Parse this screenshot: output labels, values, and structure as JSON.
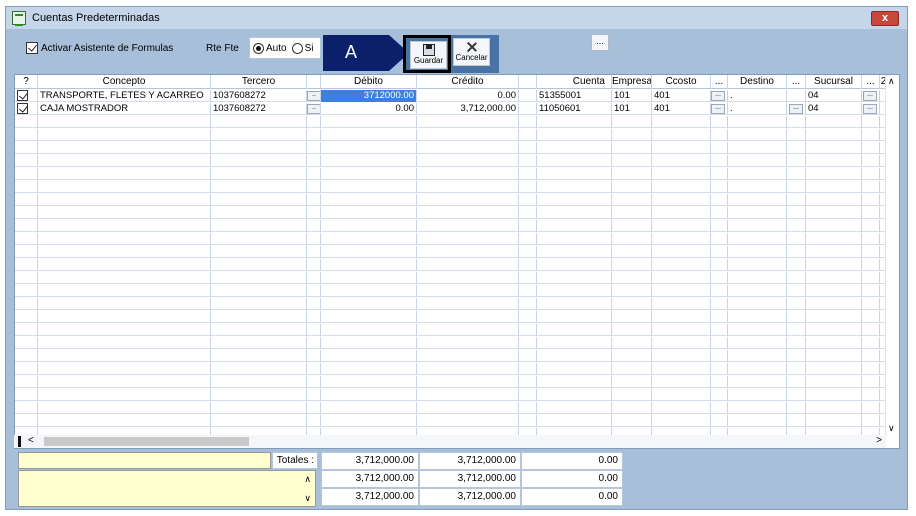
{
  "window": {
    "title": "Cuentas Predeterminadas",
    "close_label": "x"
  },
  "toolbar": {
    "asistente_label": "Activar Asistente de Formulas",
    "asistente_checked": true,
    "rte_label": "Rte Fte",
    "radio_auto_label": "Auto",
    "radio_si_label": "Si",
    "radio_selected": "Auto",
    "marker_label": "A",
    "guardar_label": "Guardar",
    "cancelar_label": "Cancelar",
    "extra_label": "..."
  },
  "grid": {
    "columns": [
      "?",
      "Concepto",
      "Tercero",
      "",
      "Débito",
      "Crédito",
      "",
      "Cuenta",
      "Empresa",
      "Ccosto",
      "...",
      "Destino",
      "...",
      "Sucursal",
      "...",
      "2"
    ],
    "rows": [
      {
        "checked": true,
        "concepto": "TRANSPORTE, FLETES Y ACARREO",
        "tercero": "1037608272",
        "debito": "3712000.00",
        "credito": "0.00",
        "cuenta": "51355001",
        "empresa": "101",
        "ccosto": "401",
        "destino": ".",
        "sucursal": "04"
      },
      {
        "checked": true,
        "concepto": "CAJA MOSTRADOR",
        "tercero": "1037608272",
        "debito": "0.00",
        "credito": "3,712,000.00",
        "cuenta": "11050601",
        "empresa": "101",
        "ccosto": "401",
        "destino": ".",
        "sucursal": "04"
      }
    ]
  },
  "totals": {
    "label": "Totales :",
    "rows": [
      {
        "debito": "3,712,000.00",
        "credito": "3,712,000.00",
        "diff": "0.00"
      },
      {
        "debito": "3,712,000.00",
        "credito": "3,712,000.00",
        "diff": "0.00"
      },
      {
        "debito": "3,712,000.00",
        "credito": "3,712,000.00",
        "diff": "0.00"
      }
    ]
  },
  "colors": {
    "window_bg": "#a8bfd9",
    "selected_cell": "#3c7fe0",
    "marker": "#0b1f6b",
    "note_bg": "#ffffd0"
  }
}
